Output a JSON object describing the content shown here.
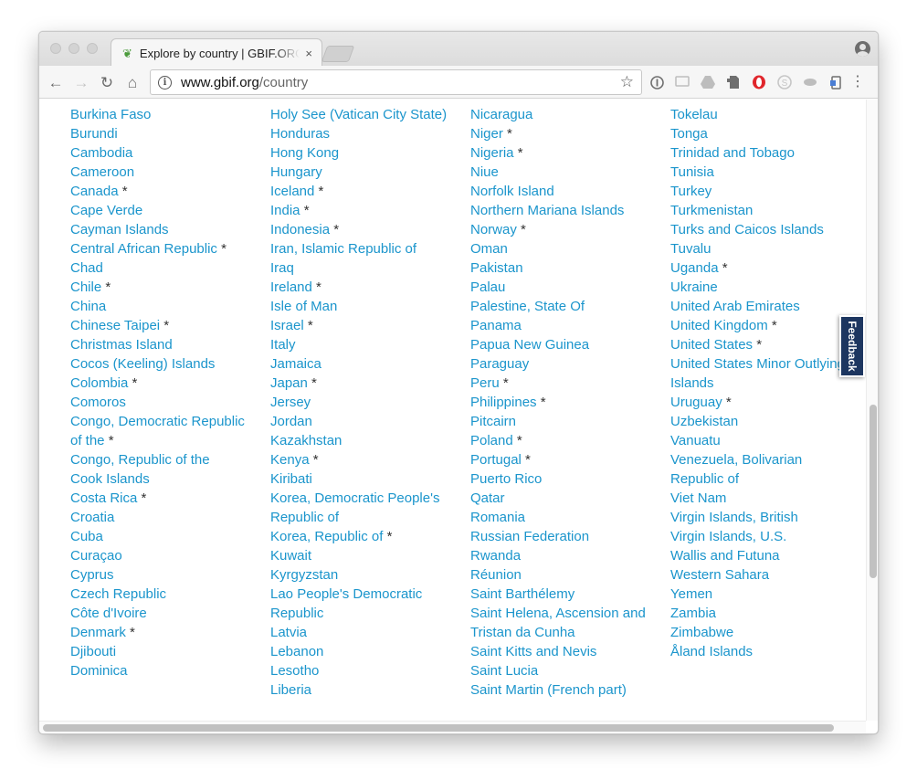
{
  "browser": {
    "tab_title": "Explore by country | GBIF.ORG",
    "tab_close": "×",
    "url_host": "www.gbif.org",
    "url_path": "/country"
  },
  "icons": {
    "back": "←",
    "forward": "→",
    "reload": "↻",
    "home": "⌂",
    "star": "☆",
    "menu": "⋮",
    "tab_favicon": "❦",
    "info": "i"
  },
  "page": {
    "partial_top_left": "",
    "feedback_label": "Feedback",
    "columns": [
      [
        {
          "name": "Burkina Faso",
          "mark": ""
        },
        {
          "name": "Burundi",
          "mark": ""
        },
        {
          "name": "Cambodia",
          "mark": ""
        },
        {
          "name": "Cameroon",
          "mark": ""
        },
        {
          "name": "Canada",
          "mark": " *"
        },
        {
          "name": "Cape Verde",
          "mark": ""
        },
        {
          "name": "Cayman Islands",
          "mark": ""
        },
        {
          "name": "Central African Republic",
          "mark": " *"
        },
        {
          "name": "Chad",
          "mark": ""
        },
        {
          "name": "Chile",
          "mark": " *"
        },
        {
          "name": "China",
          "mark": ""
        },
        {
          "name": "Chinese Taipei",
          "mark": " *"
        },
        {
          "name": "Christmas Island",
          "mark": ""
        },
        {
          "name": "Cocos (Keeling) Islands",
          "mark": ""
        },
        {
          "name": "Colombia",
          "mark": " *"
        },
        {
          "name": "Comoros",
          "mark": ""
        },
        {
          "name": "Congo, Democratic Republic of the",
          "mark": " *"
        },
        {
          "name": "Congo, Republic of the",
          "mark": ""
        },
        {
          "name": "Cook Islands",
          "mark": ""
        },
        {
          "name": "Costa Rica",
          "mark": " *"
        },
        {
          "name": "Croatia",
          "mark": ""
        },
        {
          "name": "Cuba",
          "mark": ""
        },
        {
          "name": "Curaçao",
          "mark": ""
        },
        {
          "name": "Cyprus",
          "mark": ""
        },
        {
          "name": "Czech Republic",
          "mark": ""
        },
        {
          "name": "Côte d'Ivoire",
          "mark": ""
        },
        {
          "name": "Denmark",
          "mark": " *"
        },
        {
          "name": "Djibouti",
          "mark": ""
        },
        {
          "name": "Dominica",
          "mark": ""
        }
      ],
      [
        {
          "name": "Holy See (Vatican City State)",
          "mark": ""
        },
        {
          "name": "Honduras",
          "mark": ""
        },
        {
          "name": "Hong Kong",
          "mark": ""
        },
        {
          "name": "Hungary",
          "mark": ""
        },
        {
          "name": "Iceland",
          "mark": " *"
        },
        {
          "name": "India",
          "mark": " *"
        },
        {
          "name": "Indonesia",
          "mark": " *"
        },
        {
          "name": "Iran, Islamic Republic of",
          "mark": ""
        },
        {
          "name": "Iraq",
          "mark": ""
        },
        {
          "name": "Ireland",
          "mark": " *"
        },
        {
          "name": "Isle of Man",
          "mark": ""
        },
        {
          "name": "Israel",
          "mark": " *"
        },
        {
          "name": "Italy",
          "mark": ""
        },
        {
          "name": "Jamaica",
          "mark": ""
        },
        {
          "name": "Japan",
          "mark": " *"
        },
        {
          "name": "Jersey",
          "mark": ""
        },
        {
          "name": "Jordan",
          "mark": ""
        },
        {
          "name": "Kazakhstan",
          "mark": ""
        },
        {
          "name": "Kenya",
          "mark": " *"
        },
        {
          "name": "Kiribati",
          "mark": ""
        },
        {
          "name": "Korea, Democratic People's Republic of",
          "mark": ""
        },
        {
          "name": "Korea, Republic of",
          "mark": " *"
        },
        {
          "name": "Kuwait",
          "mark": ""
        },
        {
          "name": "Kyrgyzstan",
          "mark": ""
        },
        {
          "name": "Lao People's Democratic Republic",
          "mark": ""
        },
        {
          "name": "Latvia",
          "mark": ""
        },
        {
          "name": "Lebanon",
          "mark": ""
        },
        {
          "name": "Lesotho",
          "mark": ""
        },
        {
          "name": "Liberia",
          "mark": ""
        }
      ],
      [
        {
          "name": "Nicaragua",
          "mark": ""
        },
        {
          "name": "Niger",
          "mark": " *"
        },
        {
          "name": "Nigeria",
          "mark": " *"
        },
        {
          "name": "Niue",
          "mark": ""
        },
        {
          "name": "Norfolk Island",
          "mark": ""
        },
        {
          "name": "Northern Mariana Islands",
          "mark": ""
        },
        {
          "name": "Norway",
          "mark": " *"
        },
        {
          "name": "Oman",
          "mark": ""
        },
        {
          "name": "Pakistan",
          "mark": ""
        },
        {
          "name": "Palau",
          "mark": ""
        },
        {
          "name": "Palestine, State Of",
          "mark": ""
        },
        {
          "name": "Panama",
          "mark": ""
        },
        {
          "name": "Papua New Guinea",
          "mark": ""
        },
        {
          "name": "Paraguay",
          "mark": ""
        },
        {
          "name": "Peru",
          "mark": " *"
        },
        {
          "name": "Philippines",
          "mark": " *"
        },
        {
          "name": "Pitcairn",
          "mark": ""
        },
        {
          "name": "Poland",
          "mark": " *"
        },
        {
          "name": "Portugal",
          "mark": " *"
        },
        {
          "name": "Puerto Rico",
          "mark": ""
        },
        {
          "name": "Qatar",
          "mark": ""
        },
        {
          "name": "Romania",
          "mark": ""
        },
        {
          "name": "Russian Federation",
          "mark": ""
        },
        {
          "name": "Rwanda",
          "mark": ""
        },
        {
          "name": "Réunion",
          "mark": ""
        },
        {
          "name": "Saint Barthélemy",
          "mark": ""
        },
        {
          "name": "Saint Helena, Ascension and Tristan da Cunha",
          "mark": ""
        },
        {
          "name": "Saint Kitts and Nevis",
          "mark": ""
        },
        {
          "name": "Saint Lucia",
          "mark": ""
        },
        {
          "name": "Saint Martin (French part)",
          "mark": ""
        }
      ],
      [
        {
          "name": "Tokelau",
          "mark": ""
        },
        {
          "name": "Tonga",
          "mark": ""
        },
        {
          "name": "Trinidad and Tobago",
          "mark": ""
        },
        {
          "name": "Tunisia",
          "mark": ""
        },
        {
          "name": "Turkey",
          "mark": ""
        },
        {
          "name": "Turkmenistan",
          "mark": ""
        },
        {
          "name": "Turks and Caicos Islands",
          "mark": ""
        },
        {
          "name": "Tuvalu",
          "mark": ""
        },
        {
          "name": "Uganda",
          "mark": " *"
        },
        {
          "name": "Ukraine",
          "mark": ""
        },
        {
          "name": "United Arab Emirates",
          "mark": ""
        },
        {
          "name": "United Kingdom",
          "mark": " *"
        },
        {
          "name": "United States",
          "mark": " *"
        },
        {
          "name": "United States Minor Outlying Islands",
          "mark": ""
        },
        {
          "name": "Uruguay",
          "mark": " *"
        },
        {
          "name": "Uzbekistan",
          "mark": ""
        },
        {
          "name": "Vanuatu",
          "mark": ""
        },
        {
          "name": "Venezuela, Bolivarian Republic of",
          "mark": ""
        },
        {
          "name": "Viet Nam",
          "mark": ""
        },
        {
          "name": "Virgin Islands, British",
          "mark": ""
        },
        {
          "name": "Virgin Islands, U.S.",
          "mark": ""
        },
        {
          "name": "Wallis and Futuna",
          "mark": ""
        },
        {
          "name": "Western Sahara",
          "mark": ""
        },
        {
          "name": "Yemen",
          "mark": ""
        },
        {
          "name": "Zambia",
          "mark": ""
        },
        {
          "name": "Zimbabwe",
          "mark": ""
        },
        {
          "name": "Åland Islands",
          "mark": ""
        }
      ]
    ]
  },
  "colors": {
    "link": "#1b95cc",
    "feedback_bg": "#1d3660",
    "favicon": "#4b9b3c"
  }
}
